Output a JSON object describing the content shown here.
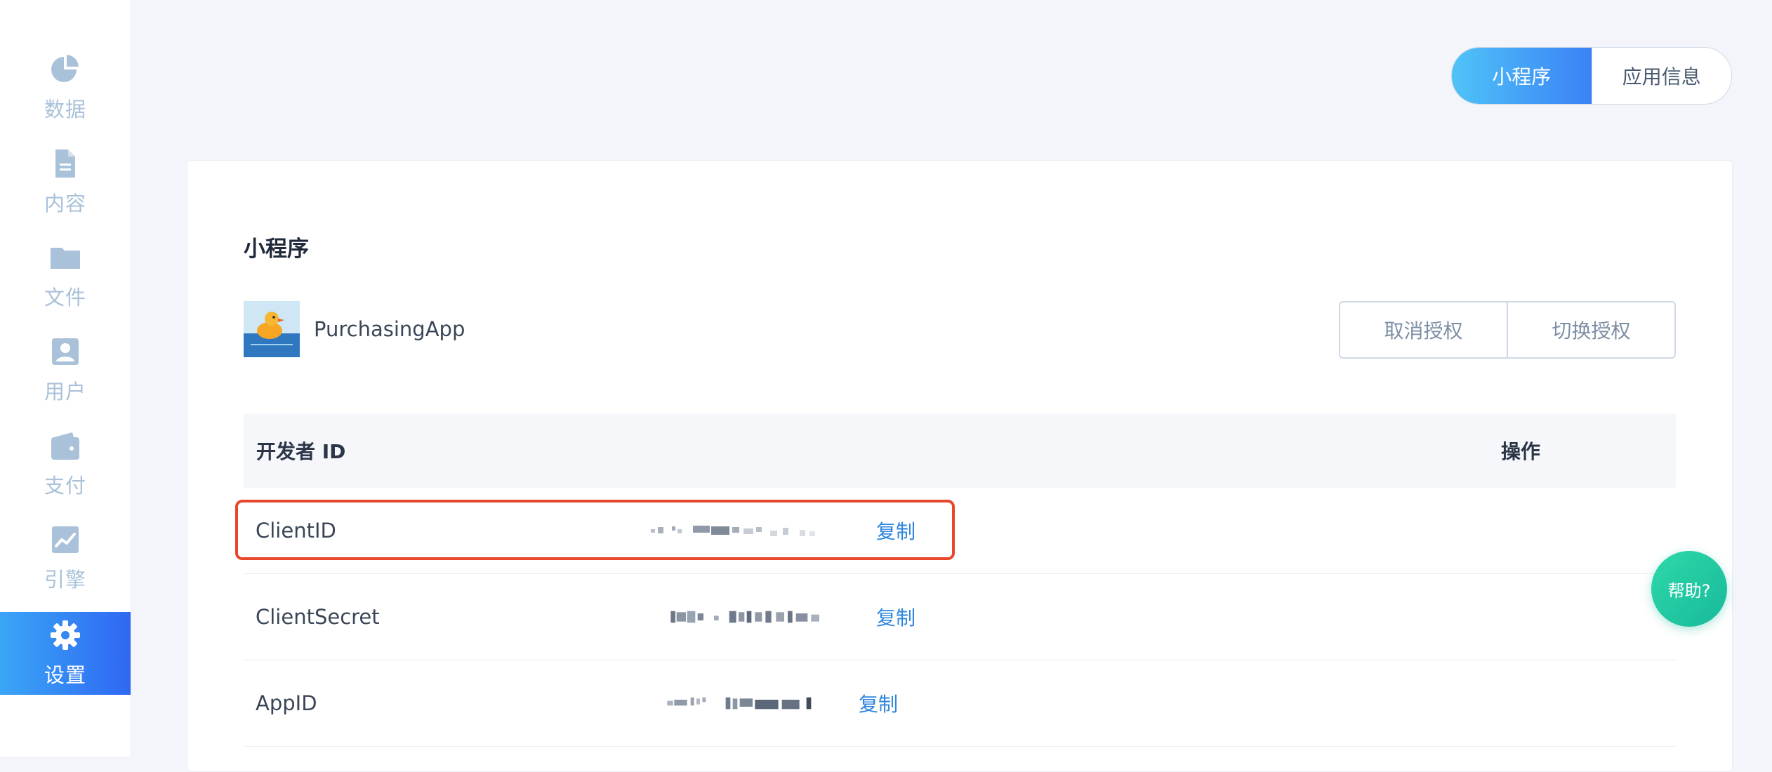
{
  "sidebar": {
    "items": [
      {
        "label": "数据",
        "icon": "pie-chart-icon"
      },
      {
        "label": "内容",
        "icon": "document-icon"
      },
      {
        "label": "文件",
        "icon": "folder-icon"
      },
      {
        "label": "用户",
        "icon": "user-card-icon"
      },
      {
        "label": "支付",
        "icon": "wallet-icon"
      },
      {
        "label": "引擎",
        "icon": "trend-chart-icon"
      },
      {
        "label": "设置",
        "icon": "gear-icon",
        "active": true
      }
    ]
  },
  "tabs": [
    {
      "label": "小程序",
      "active": true
    },
    {
      "label": "应用信息",
      "active": false
    }
  ],
  "section": {
    "title": "小程序"
  },
  "app": {
    "name": "PurchasingApp",
    "avatar_icon": "duck-avatar-icon"
  },
  "auth_buttons": {
    "cancel": "取消授权",
    "switch": "切换授权"
  },
  "table": {
    "header": {
      "left": "开发者 ID",
      "right": "操作"
    },
    "rows": [
      {
        "key": "ClientID",
        "copy": "复制",
        "highlighted": true
      },
      {
        "key": "ClientSecret",
        "copy": "复制"
      },
      {
        "key": "AppID",
        "copy": "复制"
      }
    ]
  },
  "help": {
    "label": "帮助?"
  },
  "colors": {
    "accent": "#3b82f6",
    "highlight": "#e8472a",
    "help": "#1fc7a1",
    "sidebar_icon": "#a9c1d9"
  }
}
